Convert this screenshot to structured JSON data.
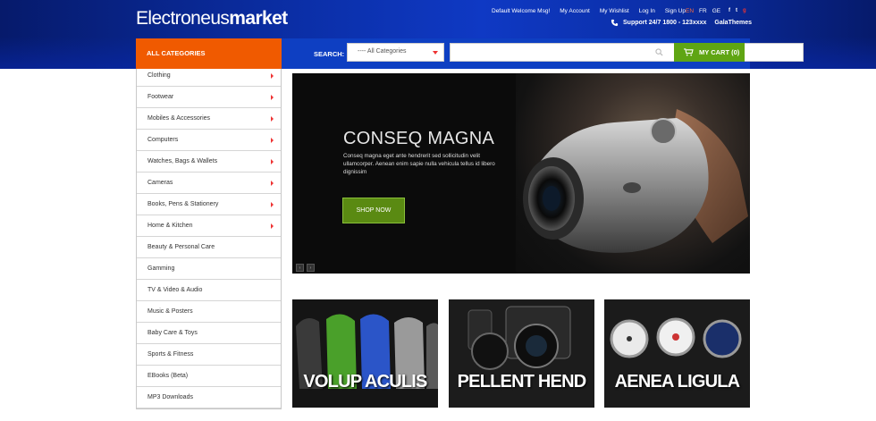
{
  "logo": {
    "light": "Electroneus",
    "bold": "market"
  },
  "top_links": [
    "Default Welcome Msg!",
    "My Account",
    "My Wishlist",
    "Log In",
    "Sign Up"
  ],
  "languages": {
    "active": "EN",
    "others": [
      "FR",
      "GE"
    ]
  },
  "social": [
    "f",
    "t",
    "g"
  ],
  "support": {
    "text": "Support 24/7 1800 - 123xxxx",
    "brand": "GalaThemes"
  },
  "search": {
    "all_categories_label": "ALL CATEGORIES",
    "label": "SEARCH:",
    "category_selected": "---- All Categories",
    "input_value": ""
  },
  "cart": {
    "label": "MY CART (0)"
  },
  "categories": [
    {
      "label": "Clothing",
      "has_sub": true
    },
    {
      "label": "Footwear",
      "has_sub": true
    },
    {
      "label": "Mobiles & Accessories",
      "has_sub": true
    },
    {
      "label": "Computers",
      "has_sub": true
    },
    {
      "label": "Watches, Bags & Wallets",
      "has_sub": true
    },
    {
      "label": "Cameras",
      "has_sub": true
    },
    {
      "label": "Books, Pens & Stationery",
      "has_sub": true
    },
    {
      "label": "Home & Kitchen",
      "has_sub": true
    },
    {
      "label": "Beauty & Personal Care",
      "has_sub": false
    },
    {
      "label": "Gamming",
      "has_sub": false
    },
    {
      "label": "TV & Video & Audio",
      "has_sub": false
    },
    {
      "label": "Music & Posters",
      "has_sub": false
    },
    {
      "label": "Baby Care & Toys",
      "has_sub": false
    },
    {
      "label": "Sports & Fitness",
      "has_sub": false
    },
    {
      "label": "EBooks (Beta)",
      "has_sub": false
    },
    {
      "label": "MP3 Downloads",
      "has_sub": false
    }
  ],
  "hero": {
    "title": "CONSEQ MAGNA",
    "description": "Conseq magna eget ante hendrerit sed sollicitudin velit ullamcorper. Aenean enim sapie nulla vehicula tellus id libero dignissim",
    "button": "SHOP NOW",
    "nav_prev": "‹",
    "nav_next": "›"
  },
  "promos": [
    {
      "caption": "VOLUP ACULIS"
    },
    {
      "caption": "PELLENT HEND"
    },
    {
      "caption": "AENEA LIGULA"
    }
  ],
  "colors": {
    "header_blue": "#0b2fa8",
    "category_orange": "#f05a00",
    "cart_green": "#5fa513",
    "accent_red": "#e33333"
  }
}
